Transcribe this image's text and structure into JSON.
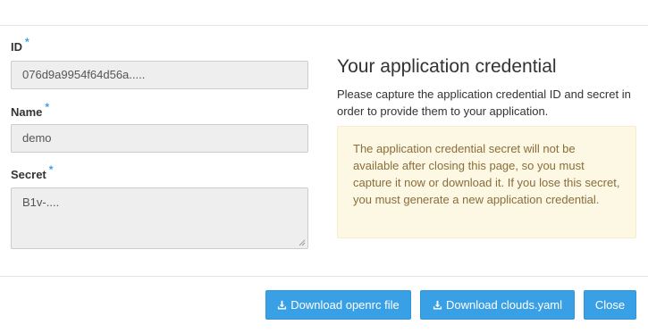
{
  "form": {
    "id": {
      "label": "ID",
      "required_mark": "*",
      "value": "076d9a9954f64d56a....."
    },
    "name": {
      "label": "Name",
      "required_mark": "*",
      "value": "demo"
    },
    "secret": {
      "label": "Secret",
      "required_mark": "*",
      "value": "B1v-...."
    }
  },
  "info": {
    "title": "Your application credential",
    "description": "Please capture the application credential ID and secret in order to provide them to your application.",
    "warning": "The application credential secret will not be available after closing this page, so you must capture it now or download it. If you lose this secret, you must generate a new application credential."
  },
  "footer": {
    "download_openrc_label": "Download openrc file",
    "download_clouds_label": "Download clouds.yaml",
    "close_label": "Close"
  },
  "colors": {
    "primary": "#3aa0e6",
    "required": "#3aa0e6",
    "warning_bg": "#fcf8e3",
    "warning_text": "#8a6d3b"
  },
  "icons": {
    "download": "download-icon",
    "resize": "resize-grip-icon"
  }
}
